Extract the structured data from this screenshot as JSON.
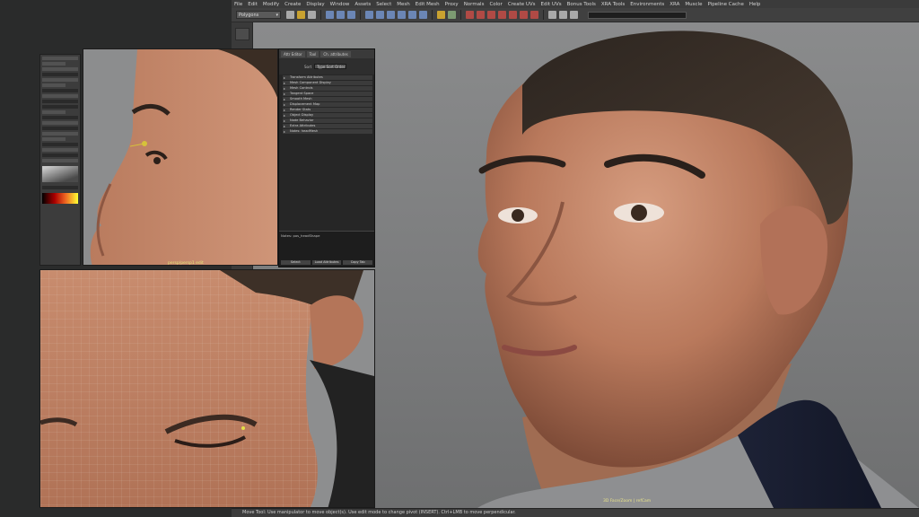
{
  "menu": {
    "items": [
      "File",
      "Edit",
      "Modify",
      "Create",
      "Display",
      "Window",
      "Assets",
      "Select",
      "Mesh",
      "Edit Mesh",
      "Proxy",
      "Normals",
      "Color",
      "Create UVs",
      "Edit UVs",
      "Bonus Tools",
      "XRA Tools",
      "Environments",
      "XRA",
      "Muscle",
      "Pipeline Cache",
      "Help"
    ]
  },
  "shelf": {
    "mode": "Polygons"
  },
  "viewports": {
    "side_label": "persp/persp1 edit",
    "main_label": "3D Face/Zoom  |  refCam",
    "close_label": "top"
  },
  "outliner": {
    "tabs": [
      "Attr Editor",
      "Tool",
      "Ch. attributes"
    ],
    "filter_label": "Sort",
    "filter_value": "Type Sort Order",
    "items": [
      "Transform Attributes",
      "Mesh Component Display",
      "Mesh Controls",
      "Tangent Space",
      "Smooth Mesh",
      "Displacement Map",
      "Render Stats",
      "Object Display",
      "Node Behavior",
      "Extra Attributes",
      "Notes: headMesh"
    ],
    "notes_caption": "Notes: pos_headShape",
    "buttons": [
      "Select",
      "Load Attributes",
      "Copy Tab"
    ]
  },
  "status": {
    "text": "Move Tool: Use manipulator to move object(s). Use edit mode to change pivot (INSERT).  Ctrl+LMB to move perpendicular."
  },
  "colors": {
    "menubar": "#3b3b3b",
    "viewport_bg": "#7d7e7f",
    "accent_yellow": "#c9a230"
  }
}
